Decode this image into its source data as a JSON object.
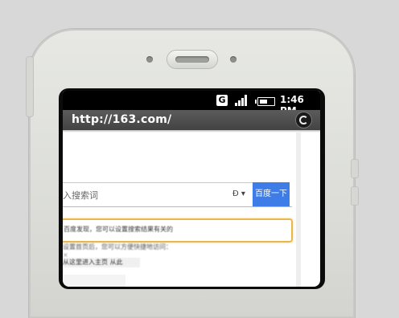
{
  "status_bar": {
    "network_badge": "G",
    "time": "1:46 PM",
    "icons": [
      "network-g-icon",
      "signal-icon",
      "battery-icon"
    ]
  },
  "browser": {
    "url": "http://163.com/",
    "refresh_icon": "refresh-icon"
  },
  "page": {
    "search": {
      "placeholder": "入搜索词",
      "dropdown_label": "Ð ▾",
      "button_label": "百度一下"
    },
    "notice": "百度发现，您可以设置搜索结果有关的",
    "tip_line1": "设置首页后，您可以方便快捷地访问：",
    "tip_line2": "×",
    "link": "从这里进入主页 从此",
    "accent_color": "#3e7de8",
    "highlight_color": "#e8b84e"
  }
}
